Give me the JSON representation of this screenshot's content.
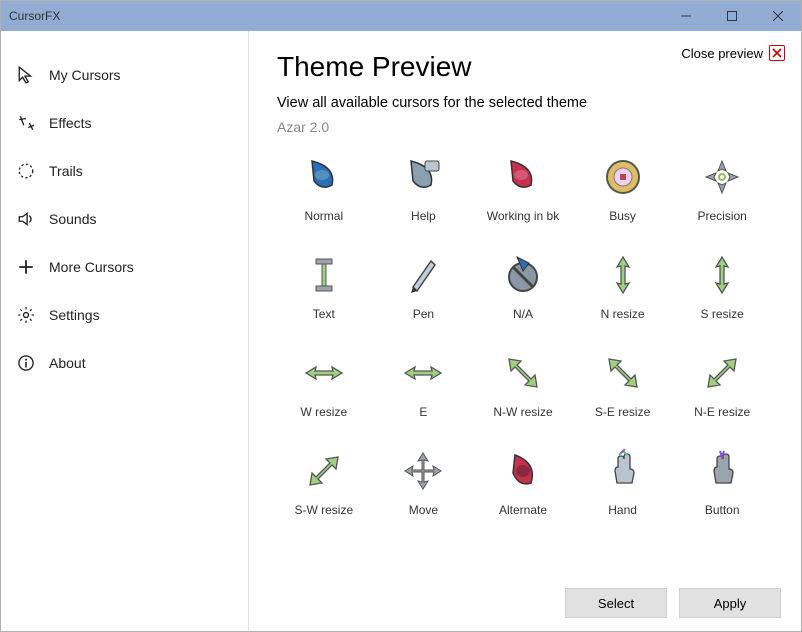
{
  "window": {
    "title": "CursorFX"
  },
  "sidebar": {
    "items": [
      {
        "label": "My Cursors",
        "icon": "cursor-icon"
      },
      {
        "label": "Effects",
        "icon": "sparkle-icon"
      },
      {
        "label": "Trails",
        "icon": "trails-icon"
      },
      {
        "label": "Sounds",
        "icon": "sound-icon"
      },
      {
        "label": "More Cursors",
        "icon": "plus-icon"
      },
      {
        "label": "Settings",
        "icon": "gear-icon"
      },
      {
        "label": "About",
        "icon": "info-icon"
      }
    ]
  },
  "main": {
    "close_preview_label": "Close preview",
    "heading": "Theme Preview",
    "subtitle": "View all available cursors for the selected theme",
    "theme_name": "Azar 2.0",
    "cursors": [
      {
        "label": "Normal"
      },
      {
        "label": "Help"
      },
      {
        "label": "Working in bk"
      },
      {
        "label": "Busy"
      },
      {
        "label": "Precision"
      },
      {
        "label": "Text"
      },
      {
        "label": "Pen"
      },
      {
        "label": "N/A"
      },
      {
        "label": "N resize"
      },
      {
        "label": "S resize"
      },
      {
        "label": "W resize"
      },
      {
        "label": "E"
      },
      {
        "label": "N-W resize"
      },
      {
        "label": "S-E resize"
      },
      {
        "label": "N-E resize"
      },
      {
        "label": "S-W resize"
      },
      {
        "label": "Move"
      },
      {
        "label": "Alternate"
      },
      {
        "label": "Hand"
      },
      {
        "label": "Button"
      }
    ]
  },
  "footer": {
    "select_label": "Select",
    "apply_label": "Apply"
  }
}
